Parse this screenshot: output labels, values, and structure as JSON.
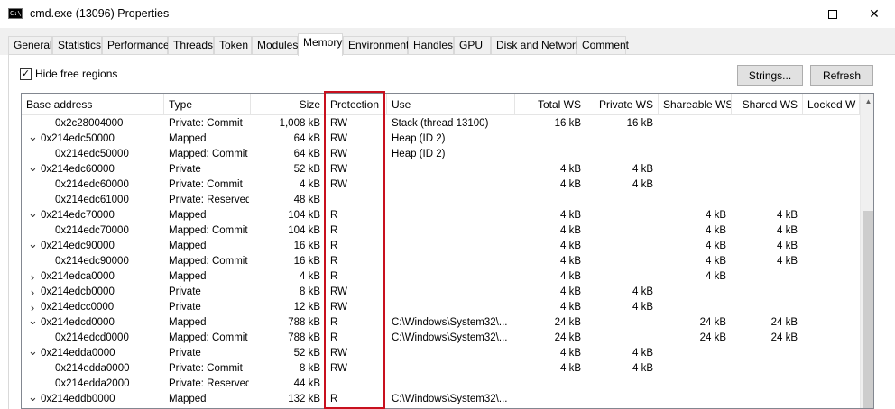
{
  "window": {
    "title": "cmd.exe (13096) Properties",
    "icon_name": "cmd-app-icon",
    "icon_text": "C:\\."
  },
  "tabs": [
    "General",
    "Statistics",
    "Performance",
    "Threads",
    "Token",
    "Modules",
    "Memory",
    "Environment",
    "Handles",
    "GPU",
    "Disk and Network",
    "Comment"
  ],
  "active_tab": "Memory",
  "options": {
    "hide_free_label": "Hide free regions",
    "hide_free_checked": true,
    "strings_label": "Strings...",
    "refresh_label": "Refresh"
  },
  "columns": [
    "Base address",
    "Type",
    "Size",
    "Protection",
    "Use",
    "Total WS",
    "Private WS",
    "Shareable WS",
    "Shared WS",
    "Locked W"
  ],
  "rows": [
    {
      "chev": "",
      "address": "0x2c28004000",
      "type": "Private: Commit",
      "size": "1,008 kB",
      "protection": "RW",
      "use": "Stack (thread 13100)",
      "total_ws": "16 kB",
      "private_ws": "16 kB",
      "shareable_ws": "",
      "shared_ws": "",
      "locked_ws": ""
    },
    {
      "chev": "v",
      "address": "0x214edc50000",
      "type": "Mapped",
      "size": "64 kB",
      "protection": "RW",
      "use": "Heap (ID 2)",
      "total_ws": "",
      "private_ws": "",
      "shareable_ws": "",
      "shared_ws": "",
      "locked_ws": ""
    },
    {
      "chev": "",
      "address": "0x214edc50000",
      "type": "Mapped: Commit",
      "size": "64 kB",
      "protection": "RW",
      "use": "Heap (ID 2)",
      "total_ws": "",
      "private_ws": "",
      "shareable_ws": "",
      "shared_ws": "",
      "locked_ws": ""
    },
    {
      "chev": "v",
      "address": "0x214edc60000",
      "type": "Private",
      "size": "52 kB",
      "protection": "RW",
      "use": "",
      "total_ws": "4 kB",
      "private_ws": "4 kB",
      "shareable_ws": "",
      "shared_ws": "",
      "locked_ws": ""
    },
    {
      "chev": "",
      "address": "0x214edc60000",
      "type": "Private: Commit",
      "size": "4 kB",
      "protection": "RW",
      "use": "",
      "total_ws": "4 kB",
      "private_ws": "4 kB",
      "shareable_ws": "",
      "shared_ws": "",
      "locked_ws": ""
    },
    {
      "chev": "",
      "address": "0x214edc61000",
      "type": "Private: Reserved",
      "size": "48 kB",
      "protection": "",
      "use": "",
      "total_ws": "",
      "private_ws": "",
      "shareable_ws": "",
      "shared_ws": "",
      "locked_ws": ""
    },
    {
      "chev": "v",
      "address": "0x214edc70000",
      "type": "Mapped",
      "size": "104 kB",
      "protection": "R",
      "use": "",
      "total_ws": "4 kB",
      "private_ws": "",
      "shareable_ws": "4 kB",
      "shared_ws": "4 kB",
      "locked_ws": ""
    },
    {
      "chev": "",
      "address": "0x214edc70000",
      "type": "Mapped: Commit",
      "size": "104 kB",
      "protection": "R",
      "use": "",
      "total_ws": "4 kB",
      "private_ws": "",
      "shareable_ws": "4 kB",
      "shared_ws": "4 kB",
      "locked_ws": ""
    },
    {
      "chev": "v",
      "address": "0x214edc90000",
      "type": "Mapped",
      "size": "16 kB",
      "protection": "R",
      "use": "",
      "total_ws": "4 kB",
      "private_ws": "",
      "shareable_ws": "4 kB",
      "shared_ws": "4 kB",
      "locked_ws": ""
    },
    {
      "chev": "",
      "address": "0x214edc90000",
      "type": "Mapped: Commit",
      "size": "16 kB",
      "protection": "R",
      "use": "",
      "total_ws": "4 kB",
      "private_ws": "",
      "shareable_ws": "4 kB",
      "shared_ws": "4 kB",
      "locked_ws": ""
    },
    {
      "chev": ">",
      "address": "0x214edca0000",
      "type": "Mapped",
      "size": "4 kB",
      "protection": "R",
      "use": "",
      "total_ws": "4 kB",
      "private_ws": "",
      "shareable_ws": "4 kB",
      "shared_ws": "",
      "locked_ws": ""
    },
    {
      "chev": ">",
      "address": "0x214edcb0000",
      "type": "Private",
      "size": "8 kB",
      "protection": "RW",
      "use": "",
      "total_ws": "4 kB",
      "private_ws": "4 kB",
      "shareable_ws": "",
      "shared_ws": "",
      "locked_ws": ""
    },
    {
      "chev": ">",
      "address": "0x214edcc0000",
      "type": "Private",
      "size": "12 kB",
      "protection": "RW",
      "use": "",
      "total_ws": "4 kB",
      "private_ws": "4 kB",
      "shareable_ws": "",
      "shared_ws": "",
      "locked_ws": ""
    },
    {
      "chev": "v",
      "address": "0x214edcd0000",
      "type": "Mapped",
      "size": "788 kB",
      "protection": "R",
      "use": "C:\\Windows\\System32\\...",
      "total_ws": "24 kB",
      "private_ws": "",
      "shareable_ws": "24 kB",
      "shared_ws": "24 kB",
      "locked_ws": ""
    },
    {
      "chev": "",
      "address": "0x214edcd0000",
      "type": "Mapped: Commit",
      "size": "788 kB",
      "protection": "R",
      "use": "C:\\Windows\\System32\\...",
      "total_ws": "24 kB",
      "private_ws": "",
      "shareable_ws": "24 kB",
      "shared_ws": "24 kB",
      "locked_ws": ""
    },
    {
      "chev": "v",
      "address": "0x214edda0000",
      "type": "Private",
      "size": "52 kB",
      "protection": "RW",
      "use": "",
      "total_ws": "4 kB",
      "private_ws": "4 kB",
      "shareable_ws": "",
      "shared_ws": "",
      "locked_ws": ""
    },
    {
      "chev": "",
      "address": "0x214edda0000",
      "type": "Private: Commit",
      "size": "8 kB",
      "protection": "RW",
      "use": "",
      "total_ws": "4 kB",
      "private_ws": "4 kB",
      "shareable_ws": "",
      "shared_ws": "",
      "locked_ws": ""
    },
    {
      "chev": "",
      "address": "0x214edda2000",
      "type": "Private: Reserved",
      "size": "44 kB",
      "protection": "",
      "use": "",
      "total_ws": "",
      "private_ws": "",
      "shareable_ws": "",
      "shared_ws": "",
      "locked_ws": ""
    },
    {
      "chev": "v",
      "address": "0x214eddb0000",
      "type": "Mapped",
      "size": "132 kB",
      "protection": "R",
      "use": "C:\\Windows\\System32\\...",
      "total_ws": "",
      "private_ws": "",
      "shareable_ws": "",
      "shared_ws": "",
      "locked_ws": ""
    }
  ],
  "highlight_color": "#c8101e"
}
